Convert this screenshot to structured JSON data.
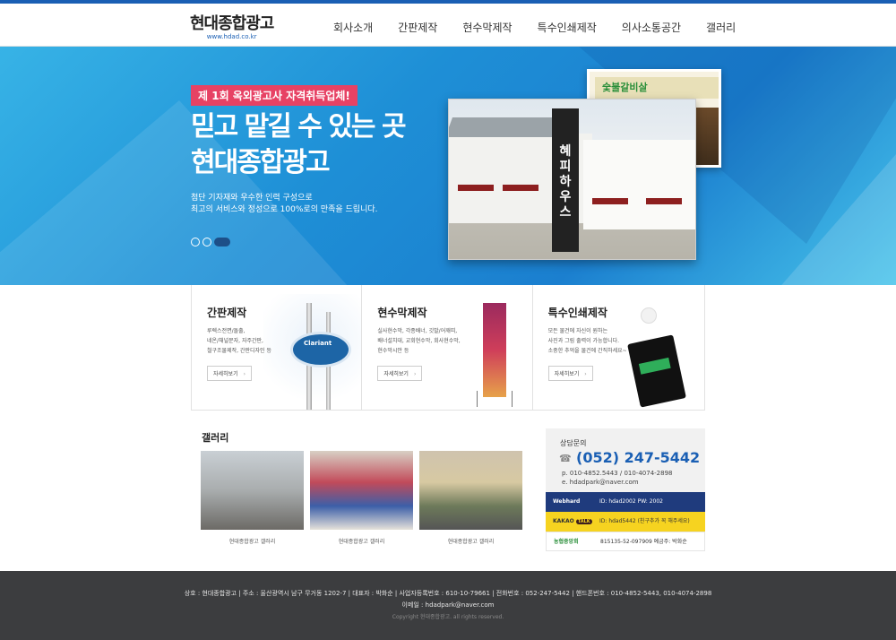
{
  "brand": {
    "title": "현대종합광고",
    "url": "www.hdad.co.kr"
  },
  "nav": [
    "회사소개",
    "간판제작",
    "현수막제작",
    "특수인쇄제작",
    "의사소통공간",
    "갤러리"
  ],
  "hero": {
    "badge": "제 1회 옥외광고사 자격취득업체!",
    "line1": "믿고 맡길 수 있는 곳",
    "line2": "현대종합광고",
    "desc1": "첨단 기자재와 우수한 인력 구성으로",
    "desc2": "최고의 서비스와 정성으로 100%로의 만족을 드립니다.",
    "photo_sign_text": "숯불갈비살",
    "pillar_text": "혜피하우스"
  },
  "services": [
    {
      "title": "간판제작",
      "desc": [
        "루렉스전면/돌출,",
        "네온/채널문자, 자주간판,",
        "철구조물제작, 간판디자인 등"
      ],
      "more": "자세히보기",
      "sign_text": "Clariant"
    },
    {
      "title": "현수막제작",
      "desc": [
        "실사현수막, 각종배너, 깃발/어깨띠,",
        "배너설치대, 교회현수막, 회사현수막,",
        "현수막시안 등"
      ],
      "more": "자세히보기"
    },
    {
      "title": "특수인쇄제작",
      "desc": [
        "모든 물건에 자신이 원하는",
        "사진과 그림 출력이 가능합니다.",
        "소중한 추억을 물건에 간직하세요~"
      ],
      "more": "자세히보기"
    }
  ],
  "gallery": {
    "title": "갤러리",
    "items": [
      {
        "caption": "현대종합광고 갤러리"
      },
      {
        "caption": "현대종합광고 갤러리"
      },
      {
        "caption": "현대종합광고 갤러리"
      }
    ]
  },
  "contact": {
    "label": "상담문의",
    "phone": "(052) 247-5442",
    "mobile": "p. 010-4852.5443 / 010-4074-2898",
    "email": "e. hdadpark@naver.com",
    "webhard_label": "Webhard",
    "webhard_info": "ID: hdad2002  PW: 2002",
    "kakao_label": "KAKAO",
    "kakao_talk": "TALK",
    "kakao_info": "ID: hdad5442 (친구추가 꼭 해주세요)",
    "bank_label": "농협중앙회",
    "bank_info": "815135-52-097909  예금주: 박화순"
  },
  "footer": {
    "line1": "상호 : 현대종합광고  |  주소 : 울산광역시 남구 무거동 1202-7  |  대표자 : 박화순  |  사업자등록번호 : 610-10-79661  |  전화번호 : 052-247-5442  |  핸드폰번호 : 010-4852-5443, 010-4074-2898",
    "line2": "이메일 : hdadpark@naver.com",
    "copyright": "Copyright 현대종합광고. all rights reserved."
  },
  "colors": {
    "brand": "#1a5fb4",
    "badge": "#e74264",
    "footer": "#3c3d3f"
  }
}
